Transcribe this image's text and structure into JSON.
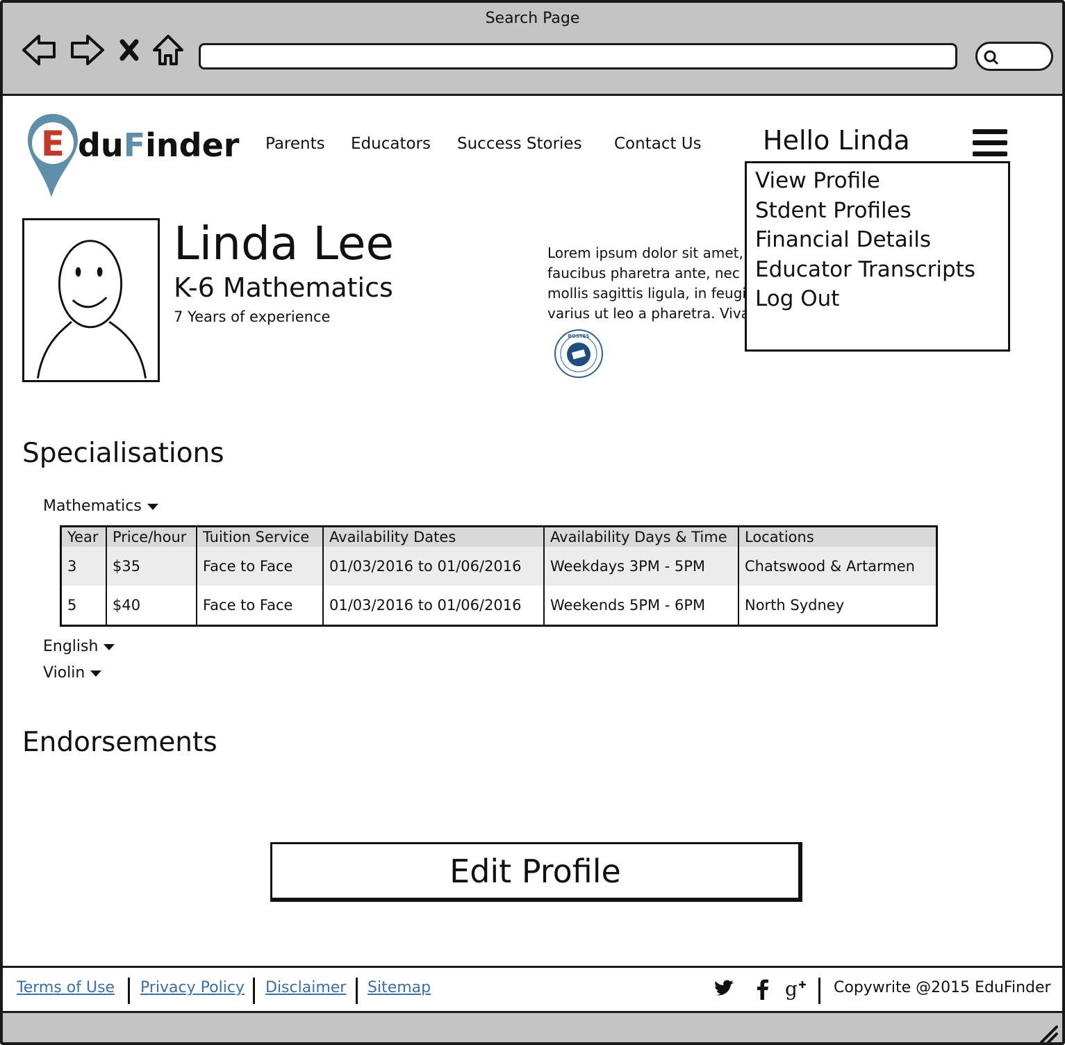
{
  "browser": {
    "title": "Search Page"
  },
  "brand": {
    "name_first": "E",
    "name_mid1": "du",
    "name_accent": "F",
    "name_rest": "inder",
    "accent_color": "#5f8fa8",
    "icons": [
      "back-arrow-icon",
      "forward-arrow-icon",
      "close-icon",
      "home-icon",
      "search-icon"
    ]
  },
  "nav": {
    "items": [
      "Parents",
      "Educators",
      "Success Stories",
      "Contact Us"
    ]
  },
  "user": {
    "greeting": "Hello Linda"
  },
  "menu": {
    "items": [
      "View Profile",
      "Stdent Profiles",
      "Financial Details",
      "Educator Transcripts",
      "Log Out"
    ]
  },
  "profile": {
    "name": "Linda Lee",
    "subject": "K-6 Mathematics",
    "experience": "7 Years of experience",
    "bio_lines": [
      "Lorem ipsum dolor sit amet, consectetur adipiscing elit.",
      "faucibus pharetra ante, nec congue turpis dictum sed. Nam",
      "mollis sagittis ligula, in feugiat lectus pulvinar quis. Cras",
      "varius ut leo a pharetra. Vivamus at elit eu mauris"
    ],
    "seal_text": "BOSTES"
  },
  "specialisations": {
    "heading": "Specialisations",
    "groups": [
      "Mathematics",
      "English",
      "Violin"
    ],
    "table": {
      "headers": [
        "Year",
        "Price/hour",
        "Tuition Service",
        "Availability Dates",
        "Availability Days & Time",
        "Locations"
      ],
      "rows": [
        [
          "3",
          "$35",
          "Face to Face",
          "01/03/2016 to 01/06/2016",
          "Weekdays 3PM - 5PM",
          "Chatswood & Artarmen"
        ],
        [
          "5",
          "$40",
          "Face to Face",
          "01/03/2016 to 01/06/2016",
          "Weekends 5PM - 6PM",
          "North Sydney"
        ]
      ]
    }
  },
  "endorsements": {
    "heading": "Endorsements"
  },
  "actions": {
    "edit_profile": "Edit Profile"
  },
  "footer": {
    "links": [
      "Terms of Use",
      "Privacy Policy",
      "Disclaimer",
      "Sitemap"
    ],
    "copyright": "Copywrite @2015 EduFinder",
    "social_icons": [
      "twitter-icon",
      "facebook-icon",
      "google-plus-icon"
    ]
  }
}
